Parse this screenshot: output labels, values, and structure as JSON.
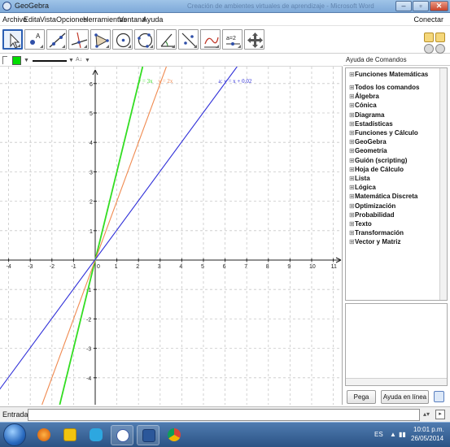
{
  "window": {
    "title": "GeoGebra",
    "background_title": "Creación de ambientes virtuales de aprendizaje - Microsoft Word"
  },
  "menubar": {
    "items": [
      "Archivo",
      "Edita",
      "Vista",
      "Opciones",
      "Herramientas",
      "Ventana",
      "Ayuda"
    ],
    "connect_label": "Conectar"
  },
  "toolbar": {
    "tools": [
      "move-tool",
      "point-tool",
      "line-tool",
      "perpendicular-tool",
      "polygon-tool",
      "circle-center-tool",
      "circle-three-points-tool",
      "angle-tool",
      "reflect-tool",
      "slider-tool",
      "move-view-tool"
    ],
    "slider_label": "a=2",
    "undo_icon": "undo-icon",
    "redo_icon": "redo-icon",
    "help_icon": "help-icon",
    "settings_icon": "gear-icon"
  },
  "stylebar": {
    "color": "#00dd00",
    "label_text": "A↓"
  },
  "graphics": {
    "x_ticks": [
      "-4",
      "-3",
      "-2",
      "-1",
      "0",
      "1",
      "2",
      "3",
      "4",
      "5",
      "6",
      "7",
      "8",
      "9",
      "10",
      "11"
    ],
    "y_ticks": [
      "6",
      "5",
      "4",
      "3",
      "2",
      "1",
      "-1",
      "-2",
      "-3",
      "-4",
      "-5"
    ],
    "lines": [
      {
        "name": "y = 3x",
        "slope": 3,
        "intercept": 0,
        "color": "#33dd22",
        "label": "y = 3x"
      },
      {
        "name": "y = 2x",
        "slope": 2,
        "intercept": 0,
        "color": "#f08a50",
        "label": "y = 2x"
      },
      {
        "name": "a: y = x + 0.02",
        "slope": 1,
        "intercept": 0.02,
        "color": "#2f2fd8",
        "label": "a: y = x + 0.02"
      }
    ],
    "grid": true
  },
  "cmdhelp": {
    "header": "Ayuda de Comandos",
    "items": [
      "Funciones Matemáticas",
      "Todos los comandos",
      "Álgebra",
      "Cónica",
      "Diagrama",
      "Estadísticas",
      "Funciones y Cálculo",
      "GeoGebra",
      "Geometría",
      "Guión (scripting)",
      "Hoja de Cálculo",
      "Lista",
      "Lógica",
      "Matemática Discreta",
      "Optimización",
      "Probabilidad",
      "Texto",
      "Transformación",
      "Vector y Matriz"
    ],
    "paste_label": "Pega",
    "online_help_label": "Ayuda en línea"
  },
  "inputbar": {
    "label": "Entrada:",
    "value": ""
  },
  "taskbar": {
    "language": "ES",
    "time": "10:01 p.m.",
    "date": "26/05/2014",
    "apps": [
      "firefox-icon",
      "windows-explorer-icon",
      "skype-icon",
      "geogebra-icon",
      "word-icon",
      "chrome-icon"
    ]
  }
}
